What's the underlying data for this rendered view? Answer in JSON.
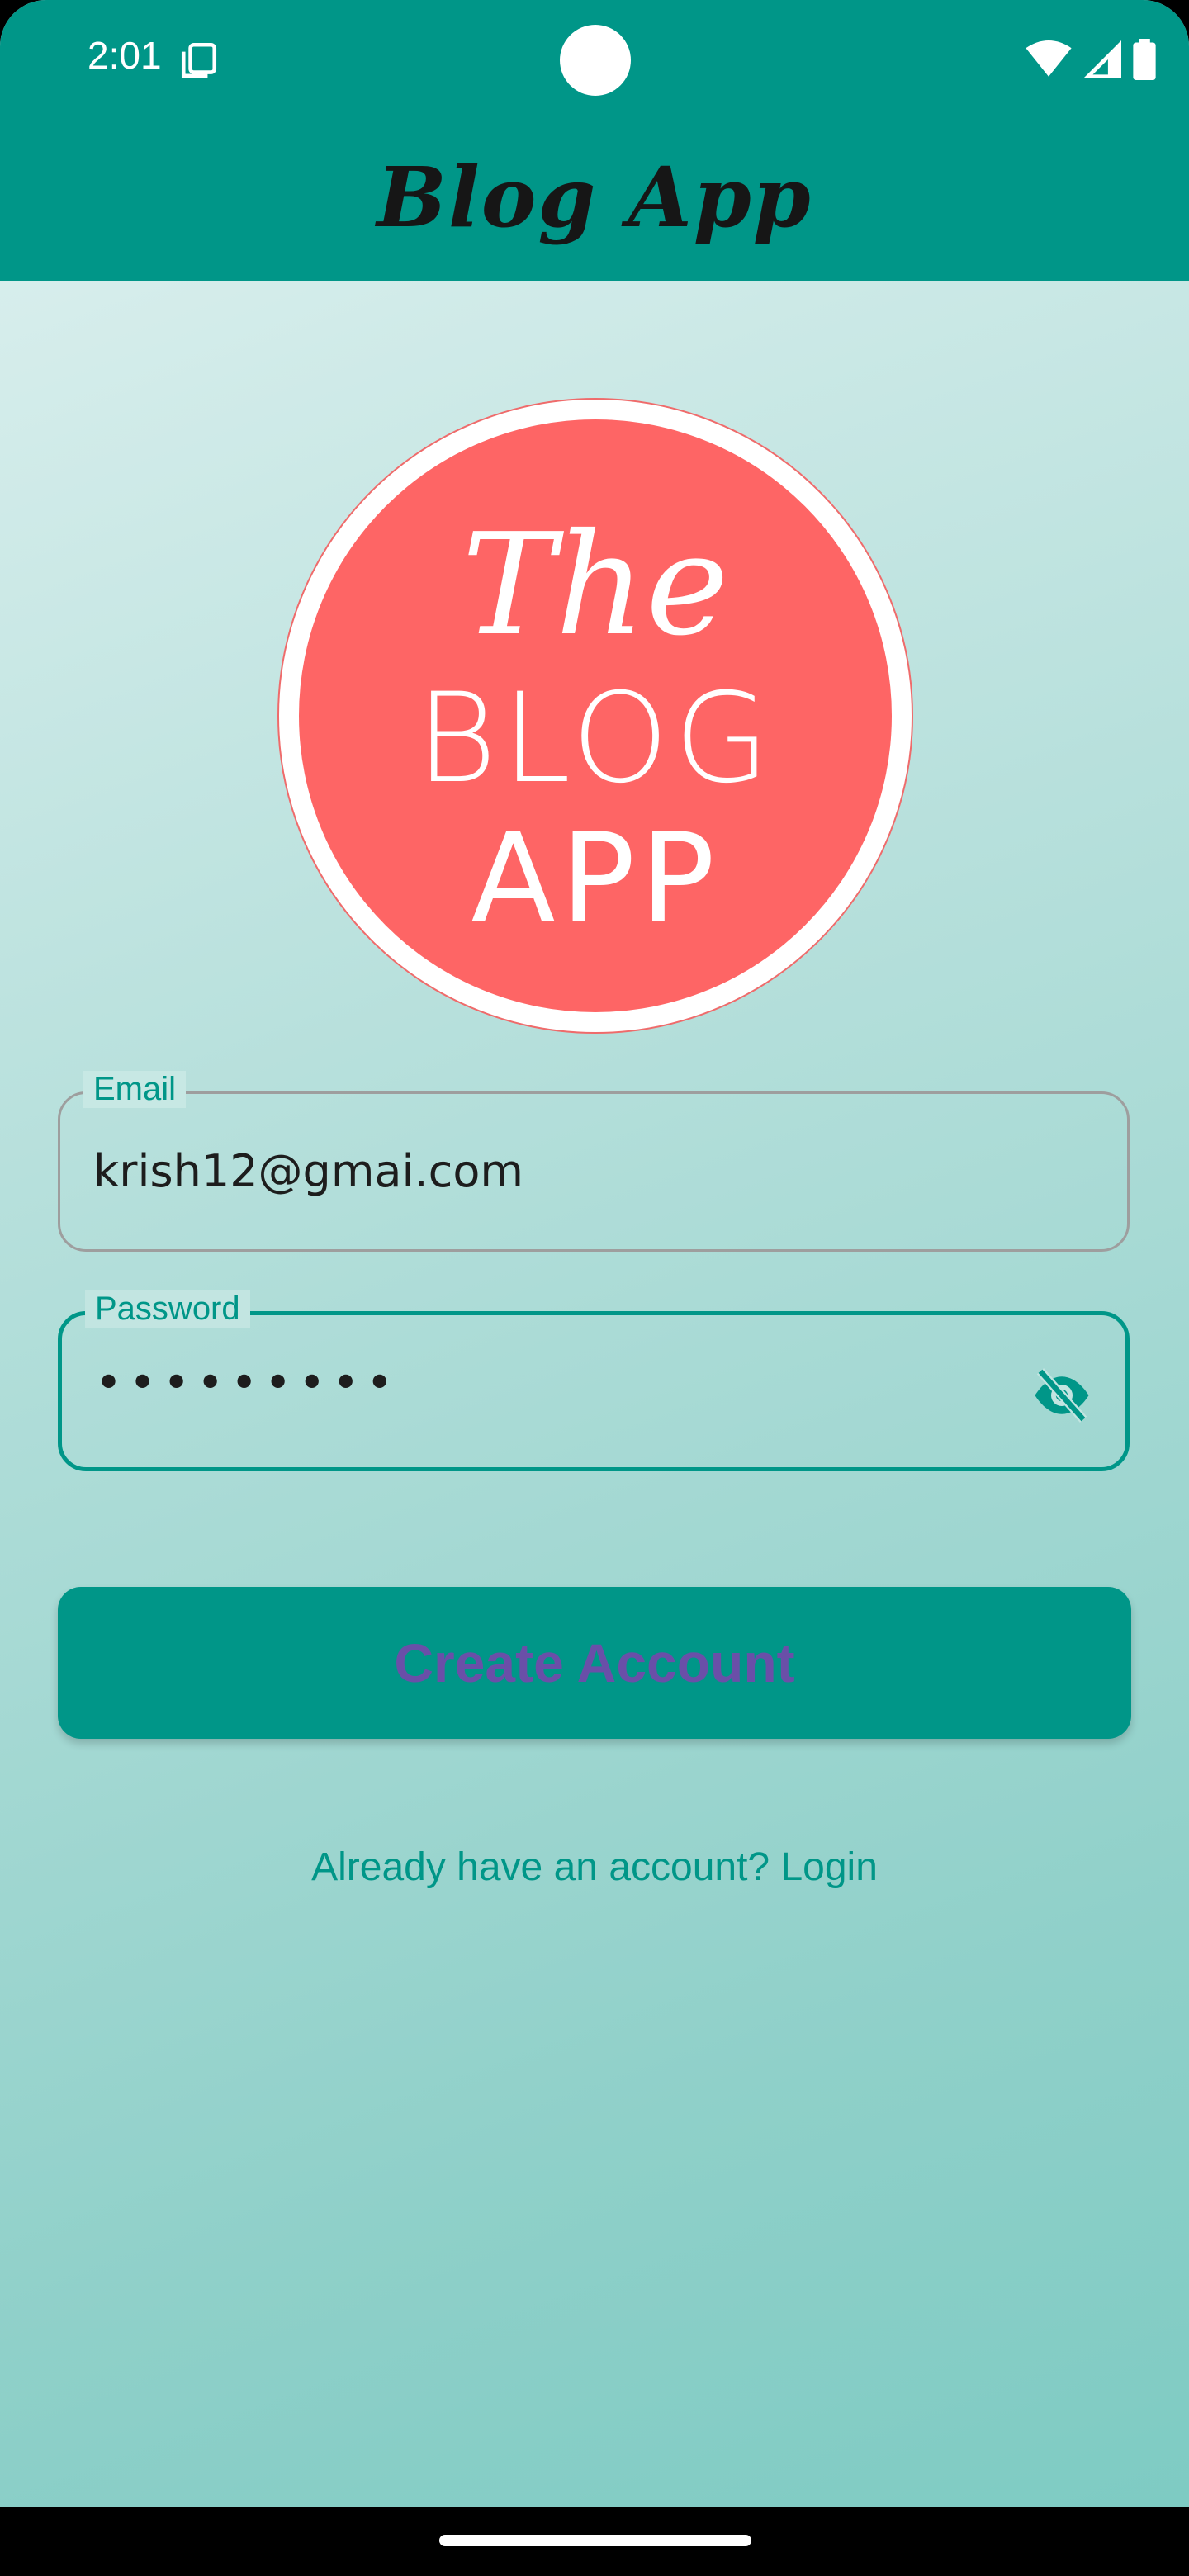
{
  "status_bar": {
    "time": "2:01"
  },
  "app_bar": {
    "title": "Blog App"
  },
  "logo": {
    "line1": "The",
    "line2": "BLOG",
    "line3": "APP"
  },
  "form": {
    "email": {
      "label": "Email",
      "value": "krish12@gmai.com"
    },
    "password": {
      "label": "Password",
      "value": "•••••••••"
    },
    "submit_label": "Create Account",
    "login_link": "Already have an account? Login"
  },
  "colors": {
    "primary": "#009688",
    "logo_red": "#fe6565",
    "button_text": "#6a4fa8"
  },
  "icons": [
    "copy-icon",
    "wifi-icon",
    "signal-icon",
    "battery-icon",
    "eye-off-icon"
  ]
}
